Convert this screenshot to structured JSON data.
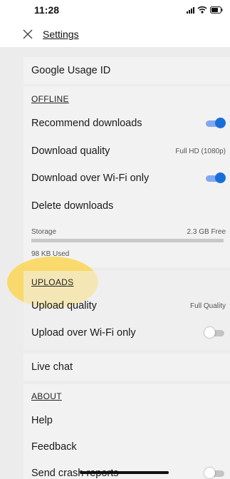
{
  "status_bar": {
    "time": "11:28",
    "icons": [
      "signal-icon",
      "wifi-icon",
      "battery-icon"
    ]
  },
  "nav": {
    "title": "Settings",
    "close_icon": "close-icon"
  },
  "google": {
    "usage_id_label": "Google Usage ID"
  },
  "offline": {
    "title": "OFFLINE",
    "recommend_downloads_label": "Recommend downloads",
    "recommend_downloads_on": true,
    "download_quality_label": "Download quality",
    "download_quality_value": "Full HD (1080p)",
    "wifi_only_label": "Download over Wi-Fi only",
    "wifi_only_on": true,
    "delete_downloads_label": "Delete downloads",
    "storage_label": "Storage",
    "storage_free": "2.3 GB Free",
    "storage_used": "98 KB Used",
    "storage_used_fraction": 0.0
  },
  "uploads": {
    "title": "UPLOADS",
    "upload_quality_label": "Upload quality",
    "upload_quality_value": "Full Quality",
    "upload_wifi_label": "Upload over Wi-Fi only",
    "upload_wifi_on": false
  },
  "live_chat": {
    "label": "Live chat"
  },
  "about": {
    "title": "ABOUT",
    "help_label": "Help",
    "feedback_label": "Feedback",
    "crash_reports_label": "Send crash reports",
    "crash_reports_on": false
  },
  "colors": {
    "toggle_on_thumb": "#1a6ed9",
    "toggle_on_track": "#7fa9ee",
    "highlight": "#fcd346"
  }
}
